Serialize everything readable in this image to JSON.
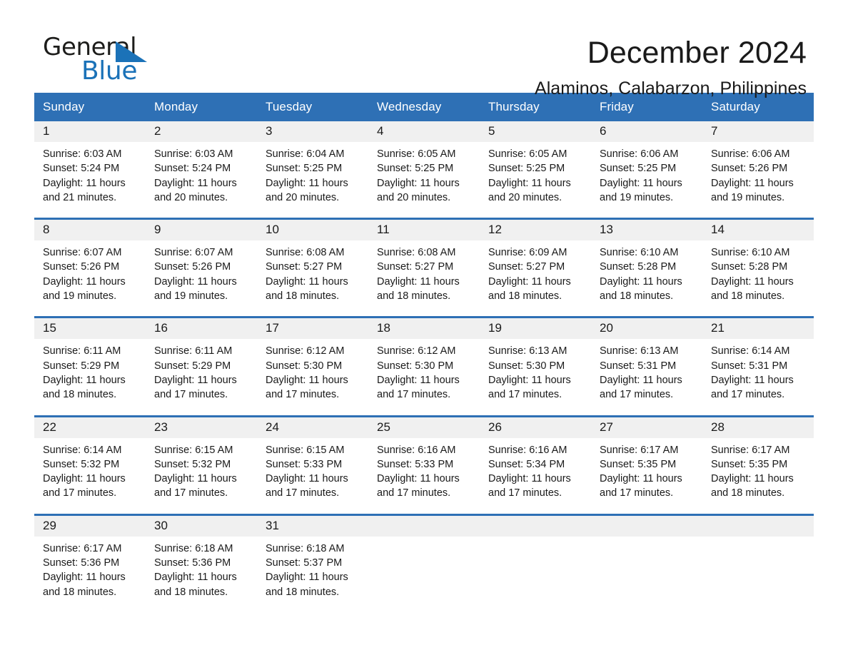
{
  "brand": {
    "name_part1": "General",
    "name_part2": "Blue",
    "triangle_color": "#1b72b8"
  },
  "header": {
    "title": "December 2024",
    "subtitle": "Alaminos, Calabarzon, Philippines"
  },
  "theme": {
    "header_blue": "#2e70b5",
    "date_band_gray": "#f0f0f0",
    "cell_white": "#ffffff",
    "text_dark": "#1a1a1a"
  },
  "weekday_headers": [
    "Sunday",
    "Monday",
    "Tuesday",
    "Wednesday",
    "Thursday",
    "Friday",
    "Saturday"
  ],
  "weeks": [
    {
      "days": [
        {
          "date": "1",
          "sunrise": "Sunrise: 6:03 AM",
          "sunset": "Sunset: 5:24 PM",
          "daylight_line1": "Daylight: 11 hours",
          "daylight_line2": "and 21 minutes."
        },
        {
          "date": "2",
          "sunrise": "Sunrise: 6:03 AM",
          "sunset": "Sunset: 5:24 PM",
          "daylight_line1": "Daylight: 11 hours",
          "daylight_line2": "and 20 minutes."
        },
        {
          "date": "3",
          "sunrise": "Sunrise: 6:04 AM",
          "sunset": "Sunset: 5:25 PM",
          "daylight_line1": "Daylight: 11 hours",
          "daylight_line2": "and 20 minutes."
        },
        {
          "date": "4",
          "sunrise": "Sunrise: 6:05 AM",
          "sunset": "Sunset: 5:25 PM",
          "daylight_line1": "Daylight: 11 hours",
          "daylight_line2": "and 20 minutes."
        },
        {
          "date": "5",
          "sunrise": "Sunrise: 6:05 AM",
          "sunset": "Sunset: 5:25 PM",
          "daylight_line1": "Daylight: 11 hours",
          "daylight_line2": "and 20 minutes."
        },
        {
          "date": "6",
          "sunrise": "Sunrise: 6:06 AM",
          "sunset": "Sunset: 5:25 PM",
          "daylight_line1": "Daylight: 11 hours",
          "daylight_line2": "and 19 minutes."
        },
        {
          "date": "7",
          "sunrise": "Sunrise: 6:06 AM",
          "sunset": "Sunset: 5:26 PM",
          "daylight_line1": "Daylight: 11 hours",
          "daylight_line2": "and 19 minutes."
        }
      ]
    },
    {
      "days": [
        {
          "date": "8",
          "sunrise": "Sunrise: 6:07 AM",
          "sunset": "Sunset: 5:26 PM",
          "daylight_line1": "Daylight: 11 hours",
          "daylight_line2": "and 19 minutes."
        },
        {
          "date": "9",
          "sunrise": "Sunrise: 6:07 AM",
          "sunset": "Sunset: 5:26 PM",
          "daylight_line1": "Daylight: 11 hours",
          "daylight_line2": "and 19 minutes."
        },
        {
          "date": "10",
          "sunrise": "Sunrise: 6:08 AM",
          "sunset": "Sunset: 5:27 PM",
          "daylight_line1": "Daylight: 11 hours",
          "daylight_line2": "and 18 minutes."
        },
        {
          "date": "11",
          "sunrise": "Sunrise: 6:08 AM",
          "sunset": "Sunset: 5:27 PM",
          "daylight_line1": "Daylight: 11 hours",
          "daylight_line2": "and 18 minutes."
        },
        {
          "date": "12",
          "sunrise": "Sunrise: 6:09 AM",
          "sunset": "Sunset: 5:27 PM",
          "daylight_line1": "Daylight: 11 hours",
          "daylight_line2": "and 18 minutes."
        },
        {
          "date": "13",
          "sunrise": "Sunrise: 6:10 AM",
          "sunset": "Sunset: 5:28 PM",
          "daylight_line1": "Daylight: 11 hours",
          "daylight_line2": "and 18 minutes."
        },
        {
          "date": "14",
          "sunrise": "Sunrise: 6:10 AM",
          "sunset": "Sunset: 5:28 PM",
          "daylight_line1": "Daylight: 11 hours",
          "daylight_line2": "and 18 minutes."
        }
      ]
    },
    {
      "days": [
        {
          "date": "15",
          "sunrise": "Sunrise: 6:11 AM",
          "sunset": "Sunset: 5:29 PM",
          "daylight_line1": "Daylight: 11 hours",
          "daylight_line2": "and 18 minutes."
        },
        {
          "date": "16",
          "sunrise": "Sunrise: 6:11 AM",
          "sunset": "Sunset: 5:29 PM",
          "daylight_line1": "Daylight: 11 hours",
          "daylight_line2": "and 17 minutes."
        },
        {
          "date": "17",
          "sunrise": "Sunrise: 6:12 AM",
          "sunset": "Sunset: 5:30 PM",
          "daylight_line1": "Daylight: 11 hours",
          "daylight_line2": "and 17 minutes."
        },
        {
          "date": "18",
          "sunrise": "Sunrise: 6:12 AM",
          "sunset": "Sunset: 5:30 PM",
          "daylight_line1": "Daylight: 11 hours",
          "daylight_line2": "and 17 minutes."
        },
        {
          "date": "19",
          "sunrise": "Sunrise: 6:13 AM",
          "sunset": "Sunset: 5:30 PM",
          "daylight_line1": "Daylight: 11 hours",
          "daylight_line2": "and 17 minutes."
        },
        {
          "date": "20",
          "sunrise": "Sunrise: 6:13 AM",
          "sunset": "Sunset: 5:31 PM",
          "daylight_line1": "Daylight: 11 hours",
          "daylight_line2": "and 17 minutes."
        },
        {
          "date": "21",
          "sunrise": "Sunrise: 6:14 AM",
          "sunset": "Sunset: 5:31 PM",
          "daylight_line1": "Daylight: 11 hours",
          "daylight_line2": "and 17 minutes."
        }
      ]
    },
    {
      "days": [
        {
          "date": "22",
          "sunrise": "Sunrise: 6:14 AM",
          "sunset": "Sunset: 5:32 PM",
          "daylight_line1": "Daylight: 11 hours",
          "daylight_line2": "and 17 minutes."
        },
        {
          "date": "23",
          "sunrise": "Sunrise: 6:15 AM",
          "sunset": "Sunset: 5:32 PM",
          "daylight_line1": "Daylight: 11 hours",
          "daylight_line2": "and 17 minutes."
        },
        {
          "date": "24",
          "sunrise": "Sunrise: 6:15 AM",
          "sunset": "Sunset: 5:33 PM",
          "daylight_line1": "Daylight: 11 hours",
          "daylight_line2": "and 17 minutes."
        },
        {
          "date": "25",
          "sunrise": "Sunrise: 6:16 AM",
          "sunset": "Sunset: 5:33 PM",
          "daylight_line1": "Daylight: 11 hours",
          "daylight_line2": "and 17 minutes."
        },
        {
          "date": "26",
          "sunrise": "Sunrise: 6:16 AM",
          "sunset": "Sunset: 5:34 PM",
          "daylight_line1": "Daylight: 11 hours",
          "daylight_line2": "and 17 minutes."
        },
        {
          "date": "27",
          "sunrise": "Sunrise: 6:17 AM",
          "sunset": "Sunset: 5:35 PM",
          "daylight_line1": "Daylight: 11 hours",
          "daylight_line2": "and 17 minutes."
        },
        {
          "date": "28",
          "sunrise": "Sunrise: 6:17 AM",
          "sunset": "Sunset: 5:35 PM",
          "daylight_line1": "Daylight: 11 hours",
          "daylight_line2": "and 18 minutes."
        }
      ]
    },
    {
      "days": [
        {
          "date": "29",
          "sunrise": "Sunrise: 6:17 AM",
          "sunset": "Sunset: 5:36 PM",
          "daylight_line1": "Daylight: 11 hours",
          "daylight_line2": "and 18 minutes."
        },
        {
          "date": "30",
          "sunrise": "Sunrise: 6:18 AM",
          "sunset": "Sunset: 5:36 PM",
          "daylight_line1": "Daylight: 11 hours",
          "daylight_line2": "and 18 minutes."
        },
        {
          "date": "31",
          "sunrise": "Sunrise: 6:18 AM",
          "sunset": "Sunset: 5:37 PM",
          "daylight_line1": "Daylight: 11 hours",
          "daylight_line2": "and 18 minutes."
        },
        {
          "date": "",
          "sunrise": "",
          "sunset": "",
          "daylight_line1": "",
          "daylight_line2": ""
        },
        {
          "date": "",
          "sunrise": "",
          "sunset": "",
          "daylight_line1": "",
          "daylight_line2": ""
        },
        {
          "date": "",
          "sunrise": "",
          "sunset": "",
          "daylight_line1": "",
          "daylight_line2": ""
        },
        {
          "date": "",
          "sunrise": "",
          "sunset": "",
          "daylight_line1": "",
          "daylight_line2": ""
        }
      ]
    }
  ]
}
